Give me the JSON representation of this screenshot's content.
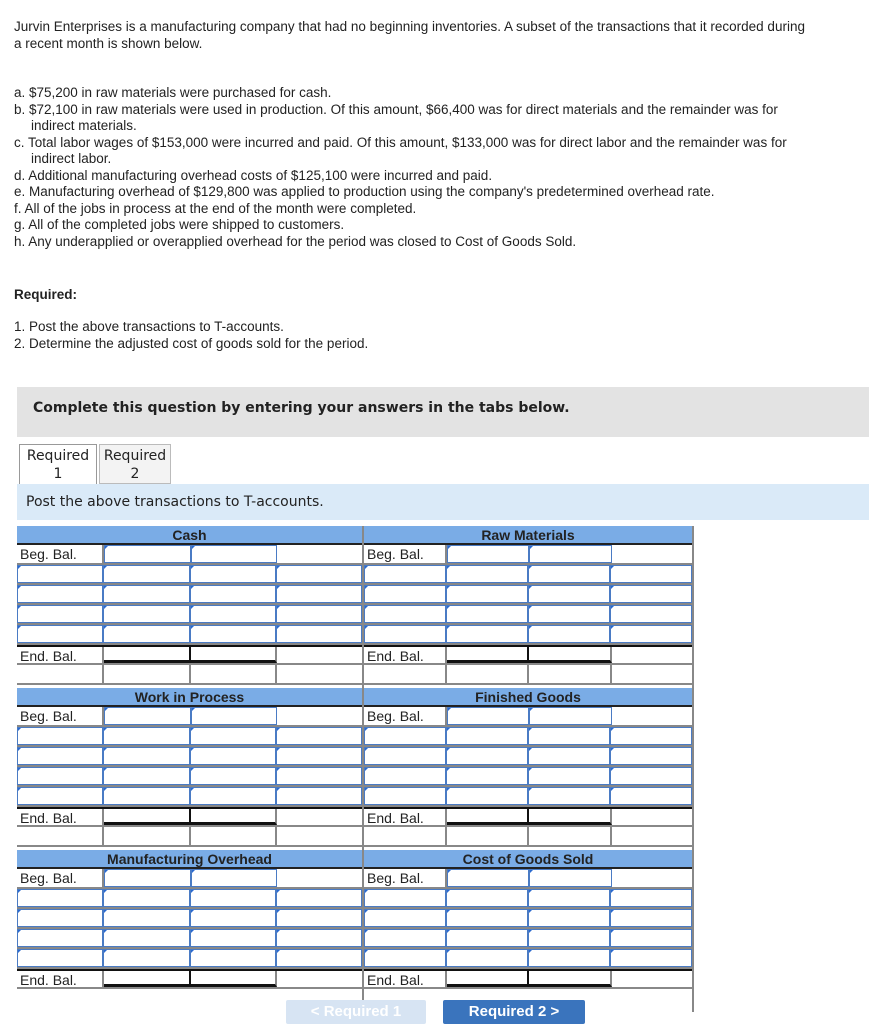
{
  "intro": "Jurvin Enterprises is a manufacturing company that had no beginning inventories. A subset of the transactions that it recorded during a recent month is shown below.",
  "transactions": [
    "a. $75,200 in raw materials were purchased for cash.",
    "b. $72,100 in raw materials were used in production. Of this amount, $66,400 was for direct materials and the remainder was for indirect materials.",
    "c. Total labor wages of $153,000 were incurred and paid. Of this amount, $133,000 was for direct labor and the remainder was for indirect labor.",
    "d. Additional manufacturing overhead costs of $125,100 were incurred and paid.",
    "e. Manufacturing overhead of $129,800 was applied to production using the company's predetermined overhead rate.",
    "f. All of the jobs in process at the end of the month were completed.",
    "g. All of the completed jobs were shipped to customers.",
    "h. Any underapplied or overapplied overhead for the period was closed to Cost of Goods Sold."
  ],
  "required_heading": "Required:",
  "required_items": [
    "1. Post the above transactions to T-accounts.",
    "2. Determine the adjusted cost of goods sold for the period."
  ],
  "banner": "Complete this question by entering your answers in the tabs below.",
  "tabs": [
    {
      "line1": "Required",
      "line2": "1"
    },
    {
      "line1": "Required",
      "line2": "2"
    }
  ],
  "instruction": "Post the above transactions to T-accounts.",
  "labels": {
    "beg": "Beg. Bal.",
    "end": "End. Bal."
  },
  "accounts": [
    "Cash",
    "Raw Materials",
    "Work in Process",
    "Finished Goods",
    "Manufacturing Overhead",
    "Cost of Goods Sold"
  ],
  "nav": {
    "prev": "< Required 1",
    "next": "Required 2  >"
  },
  "colors": {
    "header": "#7aace6",
    "next_button": "#3a74bd",
    "prev_button_disabled": "#d7e4f3"
  }
}
